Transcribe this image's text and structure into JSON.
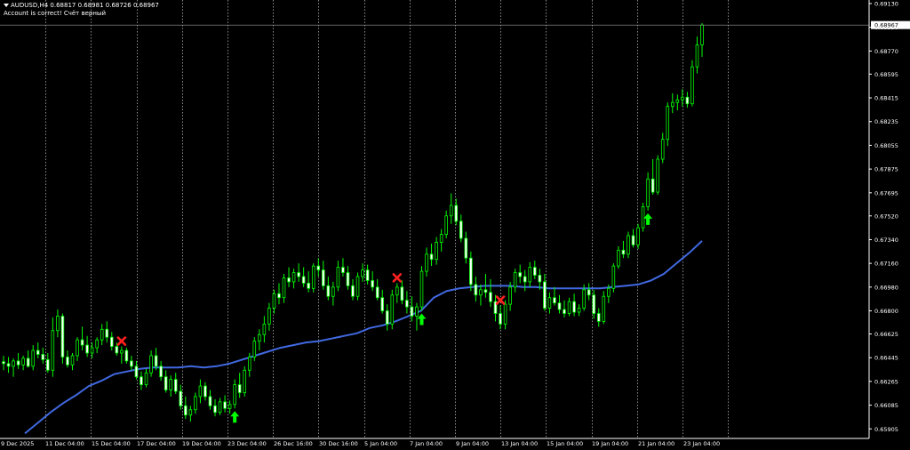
{
  "header": {
    "symbol_line": "AUDUSD,H4  0.68817 0.68981 0.68726 0.68967",
    "account_line": "Account is correct! Счёт верный"
  },
  "colors": {
    "background": "#000000",
    "candle": "#00ff00",
    "ma": "#4169e1",
    "buy_arrow": "#00ff00",
    "sell_cross": "#ff2020",
    "grid": "#c8c8c8",
    "axis_text": "#ffffff",
    "price_tag_bg": "#ffffff"
  },
  "icons": {
    "buy_signal": "arrow-up-icon",
    "sell_signal": "x-mark-icon",
    "menu": "triangle-down-icon"
  },
  "current_price": {
    "label": "0.68967",
    "value": 0.68967
  },
  "chart_data": {
    "type": "candlestick",
    "symbol": "AUDUSD",
    "timeframe": "H4",
    "ylim": [
      0.659,
      0.6913
    ],
    "price_ticks": [
      "0.69130",
      "0.68950",
      "0.68770",
      "0.68595",
      "0.68415",
      "0.68235",
      "0.68055",
      "0.67875",
      "0.67695",
      "0.67520",
      "0.67340",
      "0.67160",
      "0.66980",
      "0.66800",
      "0.66625",
      "0.66445",
      "0.66265",
      "0.66085",
      "0.65905"
    ],
    "time_labels": [
      "9 Dec 2025",
      "11 Dec 04:00",
      "15 Dec 04:00",
      "17 Dec 04:00",
      "19 Dec 04:00",
      "23 Dec 04:00",
      "26 Dec 16:00",
      "30 Dec 16:00",
      "5 Jan 04:00",
      "7 Jan 04:00",
      "9 Jan 04:00",
      "13 Jan 04:00",
      "15 Jan 04:00",
      "19 Jan 04:00",
      "21 Jan 04:00",
      "23 Jan 04:00"
    ],
    "day_separator_count": 16,
    "grid": false,
    "period_separators": true,
    "ma_values": [
      0.6587,
      0.6595,
      0.6603,
      0.661,
      0.6616,
      0.6623,
      0.6627,
      0.6632,
      0.6634,
      0.6636,
      0.6637,
      0.6637,
      0.6637,
      0.6638,
      0.6637,
      0.6638,
      0.664,
      0.6643,
      0.6646,
      0.6649,
      0.6652,
      0.6654,
      0.6656,
      0.6657,
      0.6659,
      0.6661,
      0.6663,
      0.6667,
      0.6669,
      0.6672,
      0.6676,
      0.668,
      0.669,
      0.6695,
      0.6697,
      0.6698,
      0.6699,
      0.6699,
      0.6699,
      0.6698,
      0.6698,
      0.6697,
      0.6697,
      0.6697,
      0.6697,
      0.6697,
      0.6698,
      0.6699,
      0.67,
      0.6703,
      0.6708,
      0.6716,
      0.6724,
      0.6733
    ],
    "candles": [
      [
        0.66415,
        0.6646,
        0.6635,
        0.664
      ],
      [
        0.664,
        0.6645,
        0.6633,
        0.6638
      ],
      [
        0.6638,
        0.6644,
        0.663,
        0.6642
      ],
      [
        0.6642,
        0.6648,
        0.6636,
        0.6639
      ],
      [
        0.6639,
        0.6646,
        0.6635,
        0.6644
      ],
      [
        0.6644,
        0.665,
        0.6637,
        0.6638
      ],
      [
        0.6638,
        0.6654,
        0.6635,
        0.665
      ],
      [
        0.665,
        0.6656,
        0.6644,
        0.6647
      ],
      [
        0.6647,
        0.6652,
        0.664,
        0.6643
      ],
      [
        0.6643,
        0.6648,
        0.6633,
        0.6635
      ],
      [
        0.6635,
        0.6675,
        0.663,
        0.6665
      ],
      [
        0.6665,
        0.6681,
        0.666,
        0.6676
      ],
      [
        0.6676,
        0.6678,
        0.664,
        0.6645
      ],
      [
        0.6645,
        0.665,
        0.6637,
        0.6639
      ],
      [
        0.6639,
        0.6648,
        0.6635,
        0.6646
      ],
      [
        0.6646,
        0.666,
        0.6642,
        0.6658
      ],
      [
        0.6658,
        0.6668,
        0.665,
        0.6654
      ],
      [
        0.6654,
        0.6661,
        0.6645,
        0.6648
      ],
      [
        0.6648,
        0.6656,
        0.6644,
        0.6652
      ],
      [
        0.6652,
        0.666,
        0.6648,
        0.6658
      ],
      [
        0.6658,
        0.667,
        0.6654,
        0.6666
      ],
      [
        0.6666,
        0.6672,
        0.6656,
        0.666
      ],
      [
        0.666,
        0.6664,
        0.665,
        0.6653
      ],
      [
        0.6653,
        0.6656,
        0.6646,
        0.6648
      ],
      [
        0.6648,
        0.6653,
        0.664,
        0.665
      ],
      [
        0.665,
        0.6652,
        0.664,
        0.6642
      ],
      [
        0.6642,
        0.6646,
        0.6635,
        0.6638
      ],
      [
        0.6638,
        0.6642,
        0.6628,
        0.663
      ],
      [
        0.663,
        0.6634,
        0.662,
        0.6624
      ],
      [
        0.6624,
        0.6636,
        0.6622,
        0.6633
      ],
      [
        0.6633,
        0.665,
        0.663,
        0.6646
      ],
      [
        0.6646,
        0.6652,
        0.6635,
        0.6638
      ],
      [
        0.6638,
        0.6642,
        0.6627,
        0.663
      ],
      [
        0.663,
        0.6635,
        0.6618,
        0.662
      ],
      [
        0.662,
        0.6631,
        0.6615,
        0.6628
      ],
      [
        0.6628,
        0.6633,
        0.6617,
        0.6619
      ],
      [
        0.6619,
        0.6624,
        0.6605,
        0.6608
      ],
      [
        0.6608,
        0.6615,
        0.6598,
        0.6601
      ],
      [
        0.6601,
        0.6608,
        0.6596,
        0.6605
      ],
      [
        0.6605,
        0.6618,
        0.6602,
        0.6615
      ],
      [
        0.6615,
        0.6628,
        0.661,
        0.6623
      ],
      [
        0.6623,
        0.6626,
        0.6612,
        0.6615
      ],
      [
        0.6615,
        0.662,
        0.6605,
        0.6608
      ],
      [
        0.6608,
        0.6613,
        0.66,
        0.6603
      ],
      [
        0.6603,
        0.6614,
        0.6601,
        0.6611
      ],
      [
        0.6611,
        0.6616,
        0.6603,
        0.6606
      ],
      [
        0.6606,
        0.6612,
        0.6602,
        0.6609
      ],
      [
        0.6609,
        0.6628,
        0.6606,
        0.6624
      ],
      [
        0.6624,
        0.6633,
        0.6614,
        0.6618
      ],
      [
        0.6618,
        0.6638,
        0.6615,
        0.6635
      ],
      [
        0.6635,
        0.6648,
        0.663,
        0.6645
      ],
      [
        0.6645,
        0.666,
        0.6642,
        0.6657
      ],
      [
        0.6657,
        0.6666,
        0.665,
        0.6662
      ],
      [
        0.6662,
        0.6676,
        0.6656,
        0.667
      ],
      [
        0.667,
        0.6686,
        0.6665,
        0.6682
      ],
      [
        0.6682,
        0.6696,
        0.6678,
        0.6693
      ],
      [
        0.6693,
        0.6701,
        0.6685,
        0.669
      ],
      [
        0.669,
        0.6708,
        0.6686,
        0.6705
      ],
      [
        0.6705,
        0.6713,
        0.6698,
        0.6702
      ],
      [
        0.6702,
        0.6712,
        0.6697,
        0.6709
      ],
      [
        0.6709,
        0.6716,
        0.6702,
        0.6706
      ],
      [
        0.6706,
        0.6713,
        0.6698,
        0.6701
      ],
      [
        0.6701,
        0.671,
        0.6694,
        0.6697
      ],
      [
        0.6697,
        0.6716,
        0.6694,
        0.6714
      ],
      [
        0.6714,
        0.672,
        0.6706,
        0.6711
      ],
      [
        0.6711,
        0.6718,
        0.6696,
        0.6699
      ],
      [
        0.6699,
        0.6706,
        0.6688,
        0.6691
      ],
      [
        0.6691,
        0.6702,
        0.6684,
        0.6698
      ],
      [
        0.6698,
        0.6718,
        0.6695,
        0.6713
      ],
      [
        0.6713,
        0.672,
        0.6706,
        0.6709
      ],
      [
        0.6709,
        0.6714,
        0.6696,
        0.6699
      ],
      [
        0.6699,
        0.6704,
        0.6688,
        0.6691
      ],
      [
        0.6691,
        0.6709,
        0.6688,
        0.6706
      ],
      [
        0.6706,
        0.6716,
        0.6702,
        0.6711
      ],
      [
        0.6711,
        0.6715,
        0.67,
        0.6703
      ],
      [
        0.6703,
        0.671,
        0.6695,
        0.6698
      ],
      [
        0.6698,
        0.6704,
        0.6688,
        0.669
      ],
      [
        0.669,
        0.6696,
        0.6678,
        0.668
      ],
      [
        0.668,
        0.6685,
        0.6665,
        0.667
      ],
      [
        0.667,
        0.6696,
        0.6666,
        0.6692
      ],
      [
        0.6692,
        0.6701,
        0.6686,
        0.6698
      ],
      [
        0.6698,
        0.6703,
        0.6685,
        0.6688
      ],
      [
        0.6688,
        0.6695,
        0.6678,
        0.6683
      ],
      [
        0.6683,
        0.6691,
        0.6672,
        0.6676
      ],
      [
        0.6676,
        0.6686,
        0.6665,
        0.6683
      ],
      [
        0.6683,
        0.6714,
        0.668,
        0.671
      ],
      [
        0.671,
        0.6728,
        0.6706,
        0.6723
      ],
      [
        0.6723,
        0.6731,
        0.6714,
        0.6719
      ],
      [
        0.6719,
        0.6736,
        0.6715,
        0.6732
      ],
      [
        0.6732,
        0.6742,
        0.6725,
        0.6738
      ],
      [
        0.6738,
        0.6756,
        0.6735,
        0.6752
      ],
      [
        0.6752,
        0.6769,
        0.6746,
        0.676
      ],
      [
        0.676,
        0.6765,
        0.6745,
        0.6748
      ],
      [
        0.6748,
        0.6753,
        0.6732,
        0.6735
      ],
      [
        0.6735,
        0.674,
        0.6716,
        0.672
      ],
      [
        0.672,
        0.6725,
        0.6695,
        0.67
      ],
      [
        0.67,
        0.6706,
        0.6687,
        0.6692
      ],
      [
        0.6692,
        0.67,
        0.6684,
        0.6696
      ],
      [
        0.6696,
        0.6708,
        0.669,
        0.6694
      ],
      [
        0.6694,
        0.6704,
        0.6683,
        0.6687
      ],
      [
        0.6687,
        0.6692,
        0.6672,
        0.6678
      ],
      [
        0.6678,
        0.6684,
        0.6666,
        0.667
      ],
      [
        0.667,
        0.6688,
        0.6666,
        0.6685
      ],
      [
        0.6685,
        0.6702,
        0.668,
        0.6698
      ],
      [
        0.6698,
        0.6712,
        0.6694,
        0.6709
      ],
      [
        0.6709,
        0.6715,
        0.6701,
        0.6706
      ],
      [
        0.6706,
        0.6711,
        0.6695,
        0.6702
      ],
      [
        0.6702,
        0.6717,
        0.6698,
        0.6713
      ],
      [
        0.6713,
        0.6718,
        0.6704,
        0.6707
      ],
      [
        0.6707,
        0.6712,
        0.6696,
        0.6702
      ],
      [
        0.6702,
        0.6708,
        0.668,
        0.6682
      ],
      [
        0.6682,
        0.6694,
        0.6678,
        0.669
      ],
      [
        0.669,
        0.6698,
        0.6684,
        0.6686
      ],
      [
        0.6686,
        0.6692,
        0.6678,
        0.6681
      ],
      [
        0.6681,
        0.6688,
        0.6675,
        0.6678
      ],
      [
        0.6678,
        0.669,
        0.6676,
        0.6687
      ],
      [
        0.6687,
        0.6693,
        0.6676,
        0.6679
      ],
      [
        0.6679,
        0.6685,
        0.6676,
        0.6682
      ],
      [
        0.6682,
        0.67,
        0.668,
        0.6696
      ],
      [
        0.6696,
        0.6701,
        0.6688,
        0.6692
      ],
      [
        0.6692,
        0.6696,
        0.6674,
        0.6678
      ],
      [
        0.6678,
        0.6682,
        0.6668,
        0.6672
      ],
      [
        0.6672,
        0.6695,
        0.667,
        0.6691
      ],
      [
        0.6691,
        0.67,
        0.6686,
        0.6697
      ],
      [
        0.6697,
        0.6716,
        0.6694,
        0.6714
      ],
      [
        0.6714,
        0.6729,
        0.6712,
        0.6726
      ],
      [
        0.6726,
        0.6733,
        0.672,
        0.6723
      ],
      [
        0.6723,
        0.674,
        0.672,
        0.6737
      ],
      [
        0.6737,
        0.6742,
        0.6728,
        0.673
      ],
      [
        0.673,
        0.6746,
        0.6727,
        0.6743
      ],
      [
        0.6743,
        0.6762,
        0.674,
        0.6759
      ],
      [
        0.6759,
        0.6785,
        0.6756,
        0.678
      ],
      [
        0.678,
        0.6795,
        0.6768,
        0.677
      ],
      [
        0.677,
        0.6798,
        0.6768,
        0.6795
      ],
      [
        0.6795,
        0.6815,
        0.6792,
        0.681
      ],
      [
        0.681,
        0.6838,
        0.6805,
        0.6835
      ],
      [
        0.6835,
        0.6845,
        0.683,
        0.6838
      ],
      [
        0.6838,
        0.6844,
        0.6832,
        0.684
      ],
      [
        0.684,
        0.6848,
        0.6835,
        0.6842
      ],
      [
        0.6842,
        0.6846,
        0.6834,
        0.6837
      ],
      [
        0.6837,
        0.687,
        0.6835,
        0.6865
      ],
      [
        0.6865,
        0.6888,
        0.686,
        0.68817
      ],
      [
        0.68817,
        0.68981,
        0.68726,
        0.68967
      ]
    ],
    "buy_signals": [
      47,
      85,
      131
    ],
    "sell_signals": [
      24,
      80,
      101
    ]
  }
}
